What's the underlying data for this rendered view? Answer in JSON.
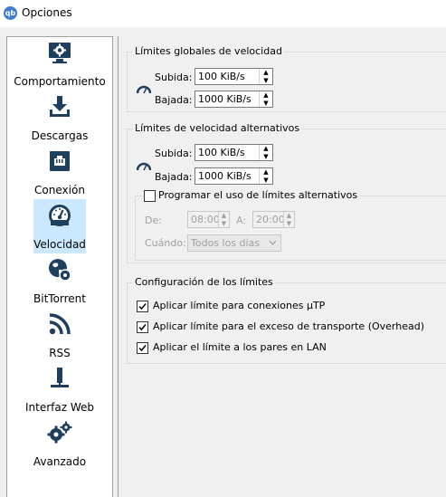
{
  "window": {
    "title": "Opciones",
    "app_icon_text": "qb"
  },
  "sidebar": {
    "items": [
      {
        "label": "Comportamiento",
        "icon": "monitor-gear-icon"
      },
      {
        "label": "Descargas",
        "icon": "download-icon"
      },
      {
        "label": "Conexión",
        "icon": "network-port-icon"
      },
      {
        "label": "Velocidad",
        "icon": "speedometer-icon",
        "selected": true
      },
      {
        "label": "BitTorrent",
        "icon": "globe-gear-icon"
      },
      {
        "label": "RSS",
        "icon": "rss-icon"
      },
      {
        "label": "Interfaz Web",
        "icon": "web-ui-icon"
      },
      {
        "label": "Avanzado",
        "icon": "gears-icon"
      }
    ]
  },
  "global_limits": {
    "title": "Límites globales de velocidad",
    "upload_label": "Subida:",
    "upload_value": "100 KiB/s",
    "download_label": "Bajada:",
    "download_value": "1000 KiB/s"
  },
  "alt_limits": {
    "title": "Límites de velocidad alternativos",
    "upload_label": "Subida:",
    "upload_value": "100 KiB/s",
    "download_label": "Bajada:",
    "download_value": "1000 KiB/s",
    "schedule": {
      "label": "Programar el uso de límites alternativos",
      "checked": false,
      "from_label": "De:",
      "from_value": "08:00",
      "to_label": "A:",
      "to_value": "20:00",
      "when_label": "Cuándo:",
      "when_value": "Todos los días"
    }
  },
  "limits_config": {
    "title": "Configuración de los límites",
    "options": [
      {
        "label": "Aplicar límite para conexiones µTP",
        "checked": true
      },
      {
        "label": "Aplicar límite para el exceso de transporte (Overhead)",
        "checked": true
      },
      {
        "label": "Aplicar el límite a los pares en LAN",
        "checked": true
      }
    ]
  },
  "colors": {
    "selection": "#cce8ff",
    "icon": "#1f3f5f",
    "accent": "#3e7ccf"
  }
}
